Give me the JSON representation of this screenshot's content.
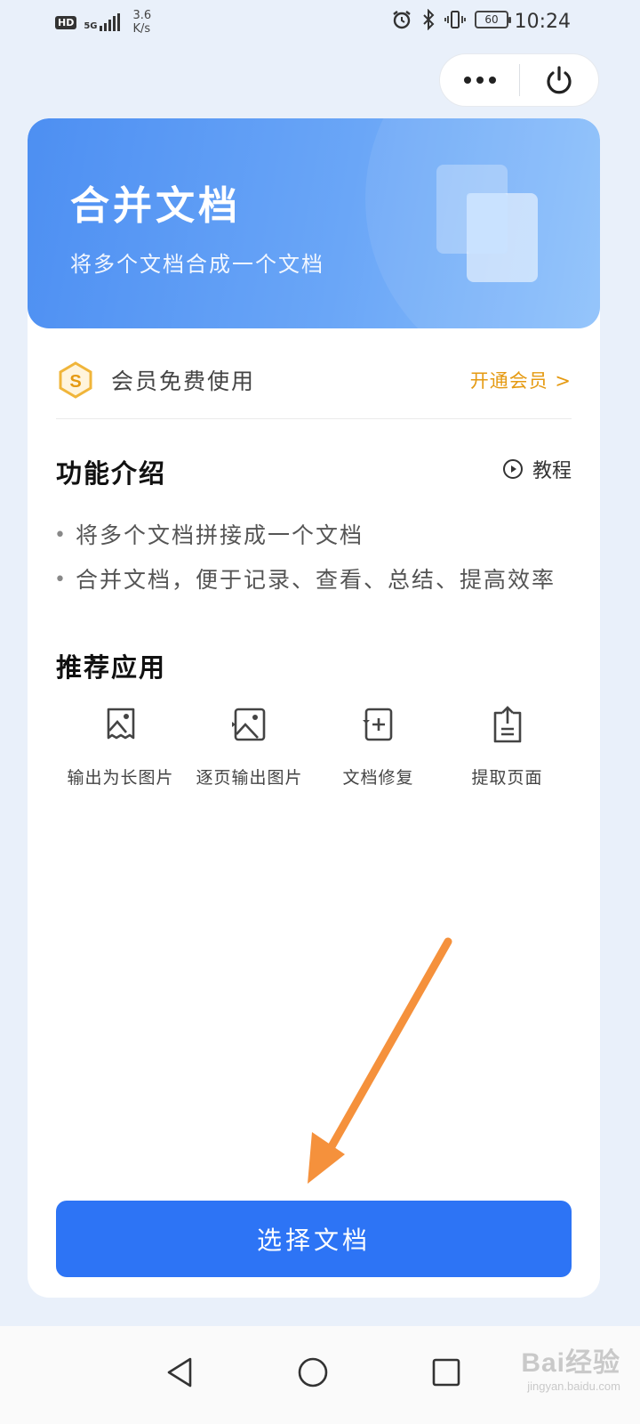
{
  "status_bar": {
    "hd": "HD",
    "network": "5G",
    "speed_value": "3.6",
    "speed_unit": "K/s",
    "battery": "60",
    "time": "10:24"
  },
  "capsule": {
    "more_icon": "more-dots-icon",
    "close_icon": "power-icon"
  },
  "hero": {
    "title": "合并文档",
    "subtitle": "将多个文档合成一个文档"
  },
  "membership": {
    "text": "会员免费使用",
    "link": "开通会员 >",
    "accent": "#e59a12"
  },
  "features": {
    "title": "功能介绍",
    "tutorial": "教程",
    "items": [
      "将多个文档拼接成一个文档",
      "合并文档，便于记录、查看、总结、提高效率"
    ]
  },
  "recommend": {
    "title": "推荐应用",
    "apps": [
      {
        "label": "输出为长图片",
        "icon": "long-image-icon"
      },
      {
        "label": "逐页输出图片",
        "icon": "page-image-icon"
      },
      {
        "label": "文档修复",
        "icon": "doc-repair-icon"
      },
      {
        "label": "提取页面",
        "icon": "extract-page-icon"
      }
    ]
  },
  "primary_button": {
    "label": "选择文档",
    "color": "#2d74f5"
  },
  "navigation": {
    "back": "back-icon",
    "home": "home-icon",
    "recent": "recent-apps-icon"
  },
  "watermark": {
    "logo": "Bai经验",
    "url": "jingyan.baidu.com"
  }
}
